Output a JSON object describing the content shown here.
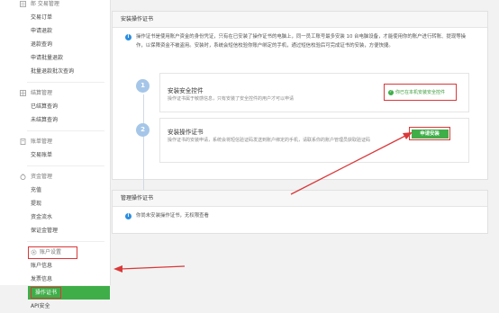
{
  "sidebar": {
    "sections": [
      {
        "title": "郎  交易管理",
        "icon": "list-icon",
        "items": [
          "交易订单",
          "申请退款",
          "退款查询",
          "申请批量退款",
          "批量退款批次查询"
        ]
      },
      {
        "title": "结算管理",
        "icon": "grid-icon",
        "items": [
          "已结算查询",
          "未结算查询"
        ]
      },
      {
        "title": "账单管理",
        "icon": "document-icon",
        "items": [
          "交易账单"
        ]
      },
      {
        "title": "资金管理",
        "icon": "money-bag-icon",
        "items": [
          "充值",
          "提现",
          "资金流水",
          "保证金管理"
        ]
      },
      {
        "title": "账户设置",
        "icon": "gear-icon",
        "items": [
          "账户信息",
          "发票信息",
          "操作证书",
          "API安全"
        ]
      }
    ]
  },
  "install_panel": {
    "title": "安装操作证书",
    "info": "操作证书是使用账户资金的身份凭证，只有在已安装了操作证书的电脑上，同一员工账号最多安装 10 台电脑设备，才能使用你的账户进行转账、提现等操作，以保障资金不被盗用。安装时，系统会短信校验你账户绑定的手机，通过短信校验后可完成证书的安装，方便快捷。",
    "step1": {
      "num": "1",
      "title": "安装安全控件",
      "desc": "操作证书属于敏感信息，只有安装了安全控件的用户才可以申请",
      "status": "你已在本机安装安全控件"
    },
    "step2": {
      "num": "2",
      "title": "安装操作证书",
      "desc": "操作证书的安装申请，系统会将短信验证码发送到账户绑定的手机，请联系你的账户管理员获取验证码",
      "button": "申请安装"
    }
  },
  "manage_panel": {
    "title": "管理操作证书",
    "info": "你尚未安装操作证书，无权限查看"
  },
  "colors": {
    "accent_green": "#3fae49",
    "annotation_red": "#d9383a",
    "info_blue": "#2b8ee0"
  }
}
